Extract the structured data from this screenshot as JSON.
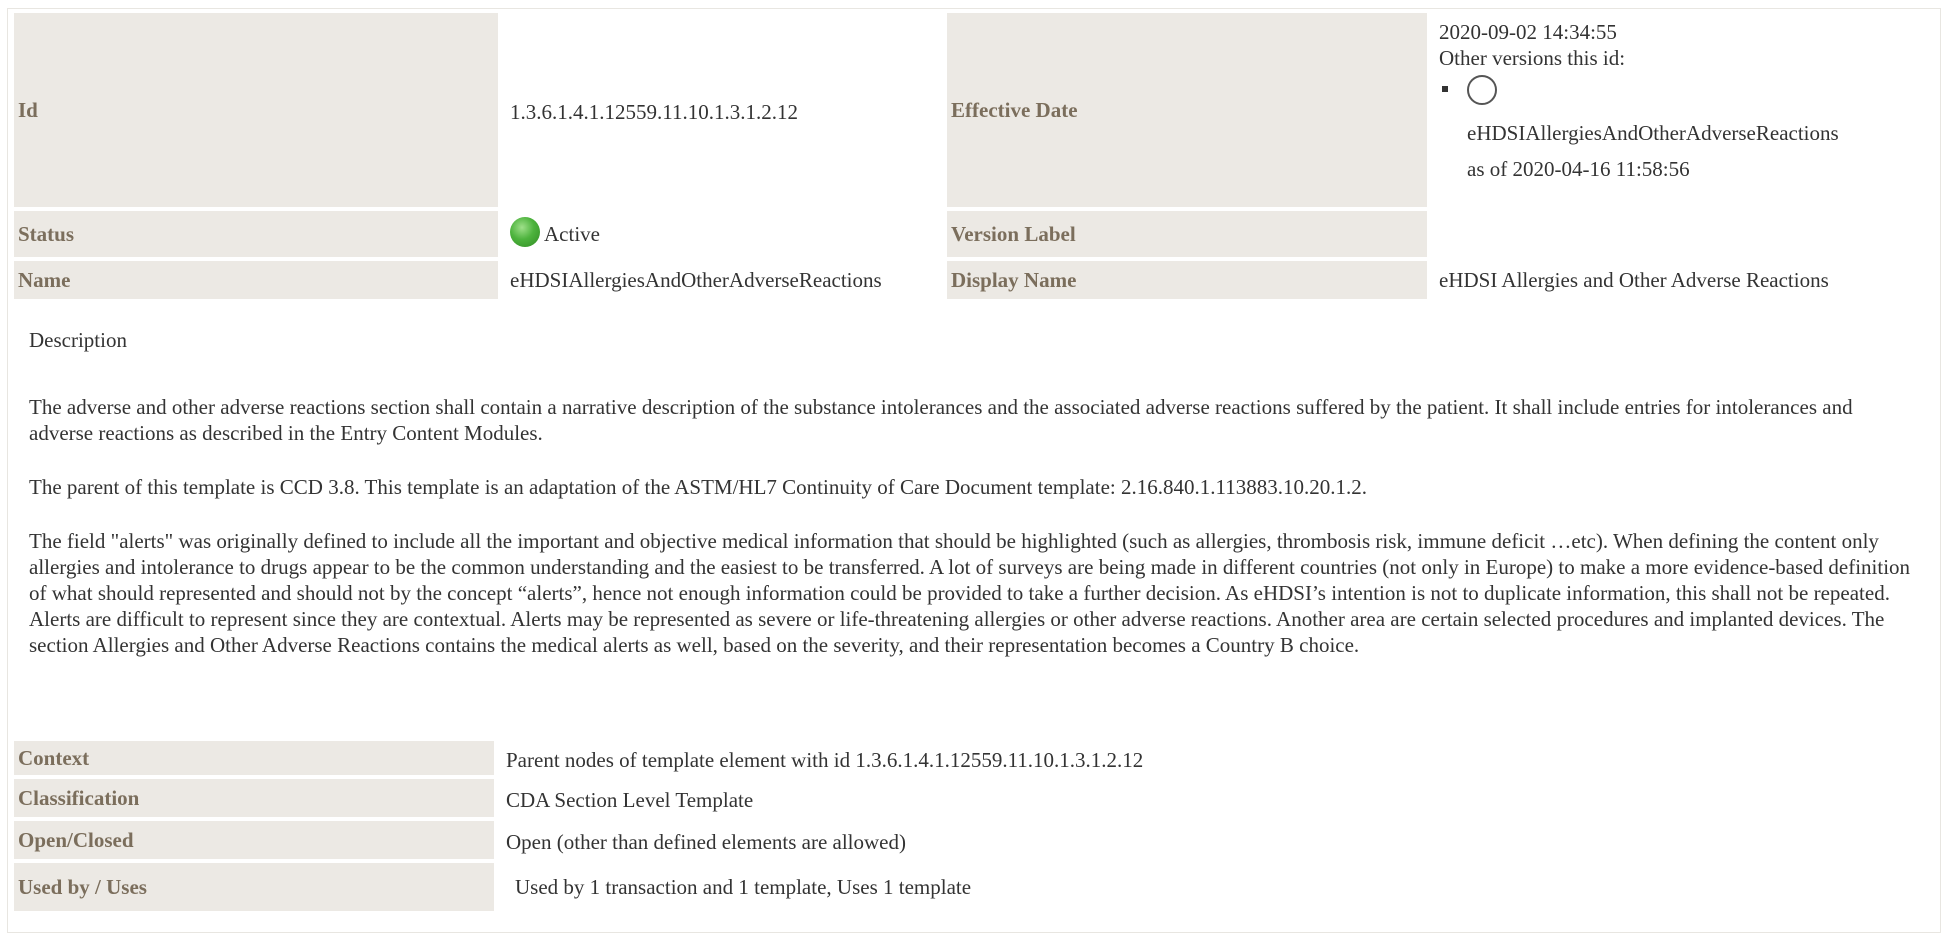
{
  "header": {
    "id_label": "Id",
    "id_value": "1.3.6.1.4.1.12559.11.10.1.3.1.2.12",
    "effective_date_label": "Effective Date",
    "effective_date_value": "2020-09-02 14:34:55",
    "other_versions_label": "Other versions this id:",
    "other_version_name": "eHDSIAllergiesAndOtherAdverseReactions",
    "other_version_date": "as of 2020-04-16 11:58:56",
    "status_label": "Status",
    "status_value": "Active",
    "status_color": "#4db33d",
    "version_label_label": "Version Label",
    "version_label_value": "",
    "name_label": "Name",
    "name_value": "eHDSIAllergiesAndOtherAdverseReactions",
    "display_name_label": "Display Name",
    "display_name_value": "eHDSI Allergies and Other Adverse Reactions"
  },
  "description": {
    "title": "Description",
    "paragraphs": [
      "The adverse and other adverse reactions section shall contain a narrative description of the substance intolerances and the associated adverse reactions suffered by the patient. It shall include entries for intolerances and adverse reactions as described in the Entry Content Modules.",
      "The parent of this template is CCD 3.8. This template is an adaptation of the ASTM/HL7 Continuity of Care Document template: 2.16.840.1.113883.10.20.1.2.",
      "The field \"alerts\" was originally defined to include all the important and objective medical information that should be highlighted (such as allergies, thrombosis risk, immune deficit …etc). When defining the content only allergies and intolerance to drugs appear to be the common understanding and the easiest to be transferred. A lot of surveys are being made in different countries (not only in Europe) to make a more evidence-based definition of what should represented and should not by the concept “alerts”, hence not enough information could be provided to take a further decision. As eHDSI’s intention is not to duplicate information, this shall not be repeated. Alerts are difficult to represent since they are contextual. Alerts may be represented as severe or life-threatening allergies or other adverse reactions. Another area are certain selected procedures and implanted devices. The section Allergies and Other Adverse Reactions contains the medical alerts as well, based on the severity, and their representation becomes a Country B choice."
    ]
  },
  "properties": {
    "context_label": "Context",
    "context_value": "Parent nodes of template element with id 1.3.6.1.4.1.12559.11.10.1.3.1.2.12",
    "classification_label": "Classification",
    "classification_value": "CDA Section Level Template",
    "open_closed_label": "Open/Closed",
    "open_closed_value": "Open (other than defined elements are allowed)",
    "used_by_label": "Used by / Uses",
    "used_by_value": "Used by 1 transaction and 1 template, Uses 1 template"
  }
}
